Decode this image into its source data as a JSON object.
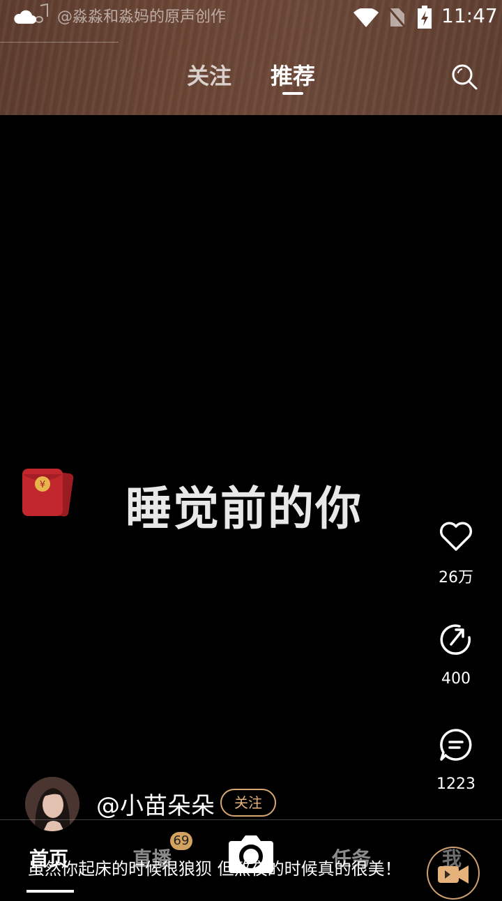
{
  "status_bar": {
    "source_text": "@淼淼和淼妈的原声创作",
    "time": "11:47"
  },
  "top_tabs": {
    "follow": "关注",
    "recommend": "推荐"
  },
  "video": {
    "caption": "睡觉前的你",
    "description": "虽然你起床的时候很狼狈 但熬夜的时候真的很美！"
  },
  "actions": {
    "likes": "26万",
    "shares": "400",
    "comments": "1223"
  },
  "author": {
    "name": "@小苗朵朵",
    "follow_label": "关注"
  },
  "bottom_nav": {
    "home": "首页",
    "live": "直播",
    "live_badge": "69",
    "task": "任务",
    "me": "我"
  },
  "colors": {
    "accent": "#e6b27c",
    "badge": "#d3a25e"
  }
}
